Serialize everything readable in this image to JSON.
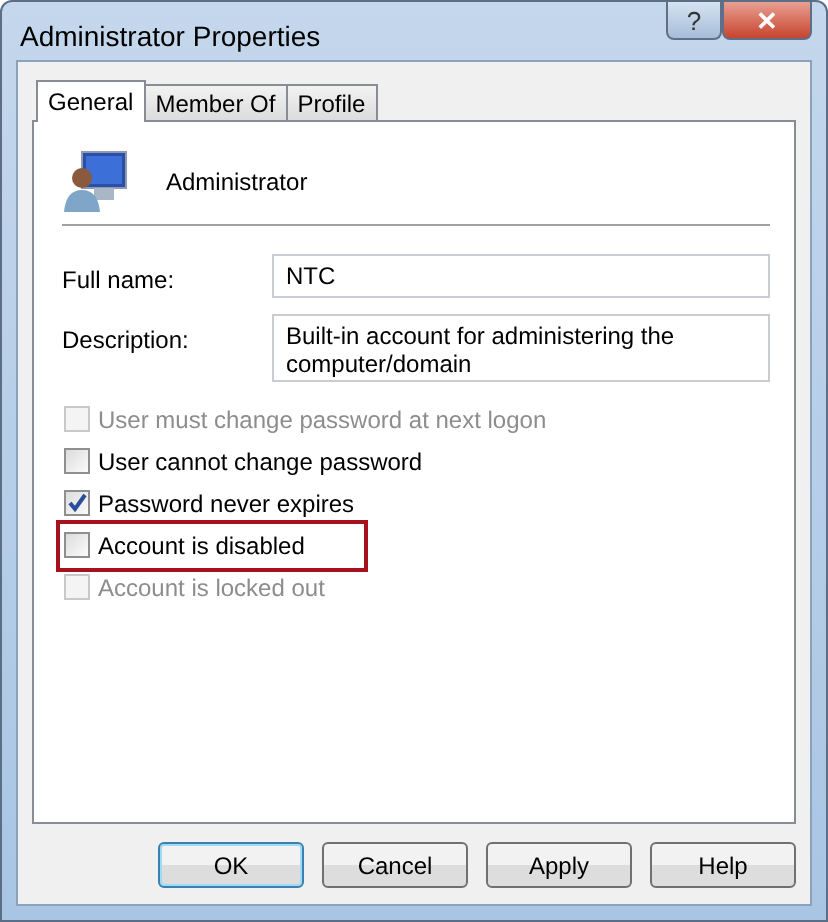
{
  "window": {
    "title": "Administrator Properties",
    "title_buttons": [
      {
        "kind": "help",
        "label": "?"
      },
      {
        "kind": "close",
        "label": "✕"
      }
    ]
  },
  "tabs": [
    {
      "label": "General",
      "selected": true
    },
    {
      "label": "Member Of",
      "selected": false
    },
    {
      "label": "Profile",
      "selected": false
    }
  ],
  "account": {
    "name": "Administrator"
  },
  "fields": [
    {
      "label": "Full name:",
      "value": "NTC"
    },
    {
      "label": "Description:",
      "value": "Built-in account for administering the computer/domain"
    }
  ],
  "checkboxes": [
    {
      "label": "User must change password at next logon",
      "checked": false,
      "disabled": true,
      "highlighted": false
    },
    {
      "label": "User cannot change password",
      "checked": false,
      "disabled": false,
      "highlighted": false
    },
    {
      "label": "Password never expires",
      "checked": true,
      "disabled": false,
      "highlighted": false
    },
    {
      "label": "Account is disabled",
      "checked": false,
      "disabled": false,
      "highlighted": true
    },
    {
      "label": "Account is locked out",
      "checked": false,
      "disabled": true,
      "highlighted": false
    }
  ],
  "buttons": [
    {
      "label": "OK",
      "default": true
    },
    {
      "label": "Cancel",
      "default": false
    },
    {
      "label": "Apply",
      "default": false
    },
    {
      "label": "Help",
      "default": false
    }
  ]
}
